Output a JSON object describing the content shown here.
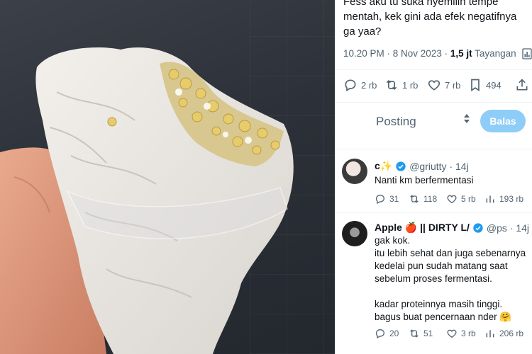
{
  "post": {
    "text": "Fess aku tu suka nyemilin tempe mentah, kek gini ada efek negatifnya ga yaa?",
    "time": "10.20 PM · 8 Nov 2023 · ",
    "views_count": "1,5 jt",
    "views_label": " Tayangan",
    "replies": "2 rb",
    "reposts": "1 rb",
    "likes": "7 rb",
    "bookmarks": "494"
  },
  "reply_box": {
    "placeholder": "Posting",
    "button": "Balas"
  },
  "replies": [
    {
      "name": "c✨",
      "handle": "@griutty · 14j",
      "text": "Nanti km berfermentasi",
      "replies": "31",
      "reposts": "118",
      "likes": "5 rb",
      "views": "193 rb"
    },
    {
      "name": "Apple 🍎 || DIRTY L/",
      "handle": "@ps · 14j",
      "text": "gak kok.\nitu lebih sehat dan juga sebenarnya kedelai pun sudah matang saat sebelum proses fermentasi.\n\nkadar proteinnya masih tinggi. bagus buat pencernaan nder 🤗",
      "replies": "20",
      "reposts": "51",
      "likes": "3 rb",
      "views": "206 rb"
    }
  ],
  "colors": {
    "accent": "#1d9bf0",
    "button_disabled": "#8ecdf8",
    "muted": "#536471"
  }
}
